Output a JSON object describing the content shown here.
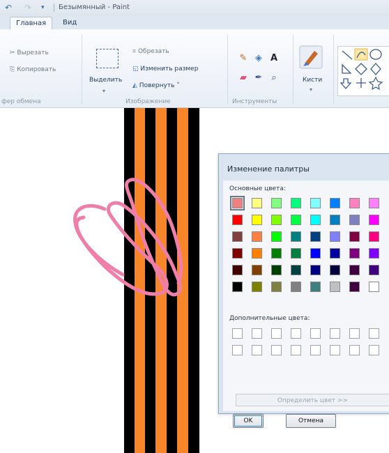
{
  "window": {
    "title": "Безымянный - Paint"
  },
  "tabs": [
    "Главная",
    "Вид"
  ],
  "ribbon": {
    "clipboard": {
      "cut": "Вырезать",
      "copy": "Копировать",
      "group_label": "фер обмена"
    },
    "image": {
      "select": "Выделить",
      "crop": "Обрезать",
      "resize": "Изменить размер",
      "rotate": "Повернуть ˅",
      "group_label": "Изображение"
    },
    "tools": {
      "group_label": "Инструменты",
      "text_tool": "A"
    },
    "brushes": {
      "label": "Кисти"
    }
  },
  "dialog": {
    "title": "Изменение палитры",
    "basic_colors_label": "Основные цвета:",
    "custom_colors_label": "Дополнительные цвета:",
    "define_button": "Определить цвет >>",
    "ok_button": "OK",
    "cancel_button": "Отмена",
    "basic_colors": [
      [
        "#f08080",
        "#ffff80",
        "#80ff80",
        "#00ff80",
        "#80ffff",
        "#0080ff",
        "#ff80c0",
        "#ff80ff"
      ],
      [
        "#ff0000",
        "#ffff00",
        "#80ff00",
        "#00ff40",
        "#00ffff",
        "#0080c0",
        "#8080c0",
        "#ff00ff"
      ],
      [
        "#804040",
        "#ff8040",
        "#00ff00",
        "#008080",
        "#004080",
        "#8080ff",
        "#800040",
        "#ff0080"
      ],
      [
        "#800000",
        "#ff8000",
        "#008000",
        "#008040",
        "#0000ff",
        "#0000a0",
        "#800080",
        "#8000ff"
      ],
      [
        "#400000",
        "#804000",
        "#004000",
        "#004040",
        "#000080",
        "#000040",
        "#400040",
        "#400080"
      ],
      [
        "#000000",
        "#808000",
        "#808040",
        "#808080",
        "#408080",
        "#c0c0c0",
        "#400040",
        "#ffffff"
      ]
    ]
  },
  "canvas_colors": {
    "black": "#000000",
    "orange": "#f7862a",
    "pink": "#ef7fa8"
  }
}
